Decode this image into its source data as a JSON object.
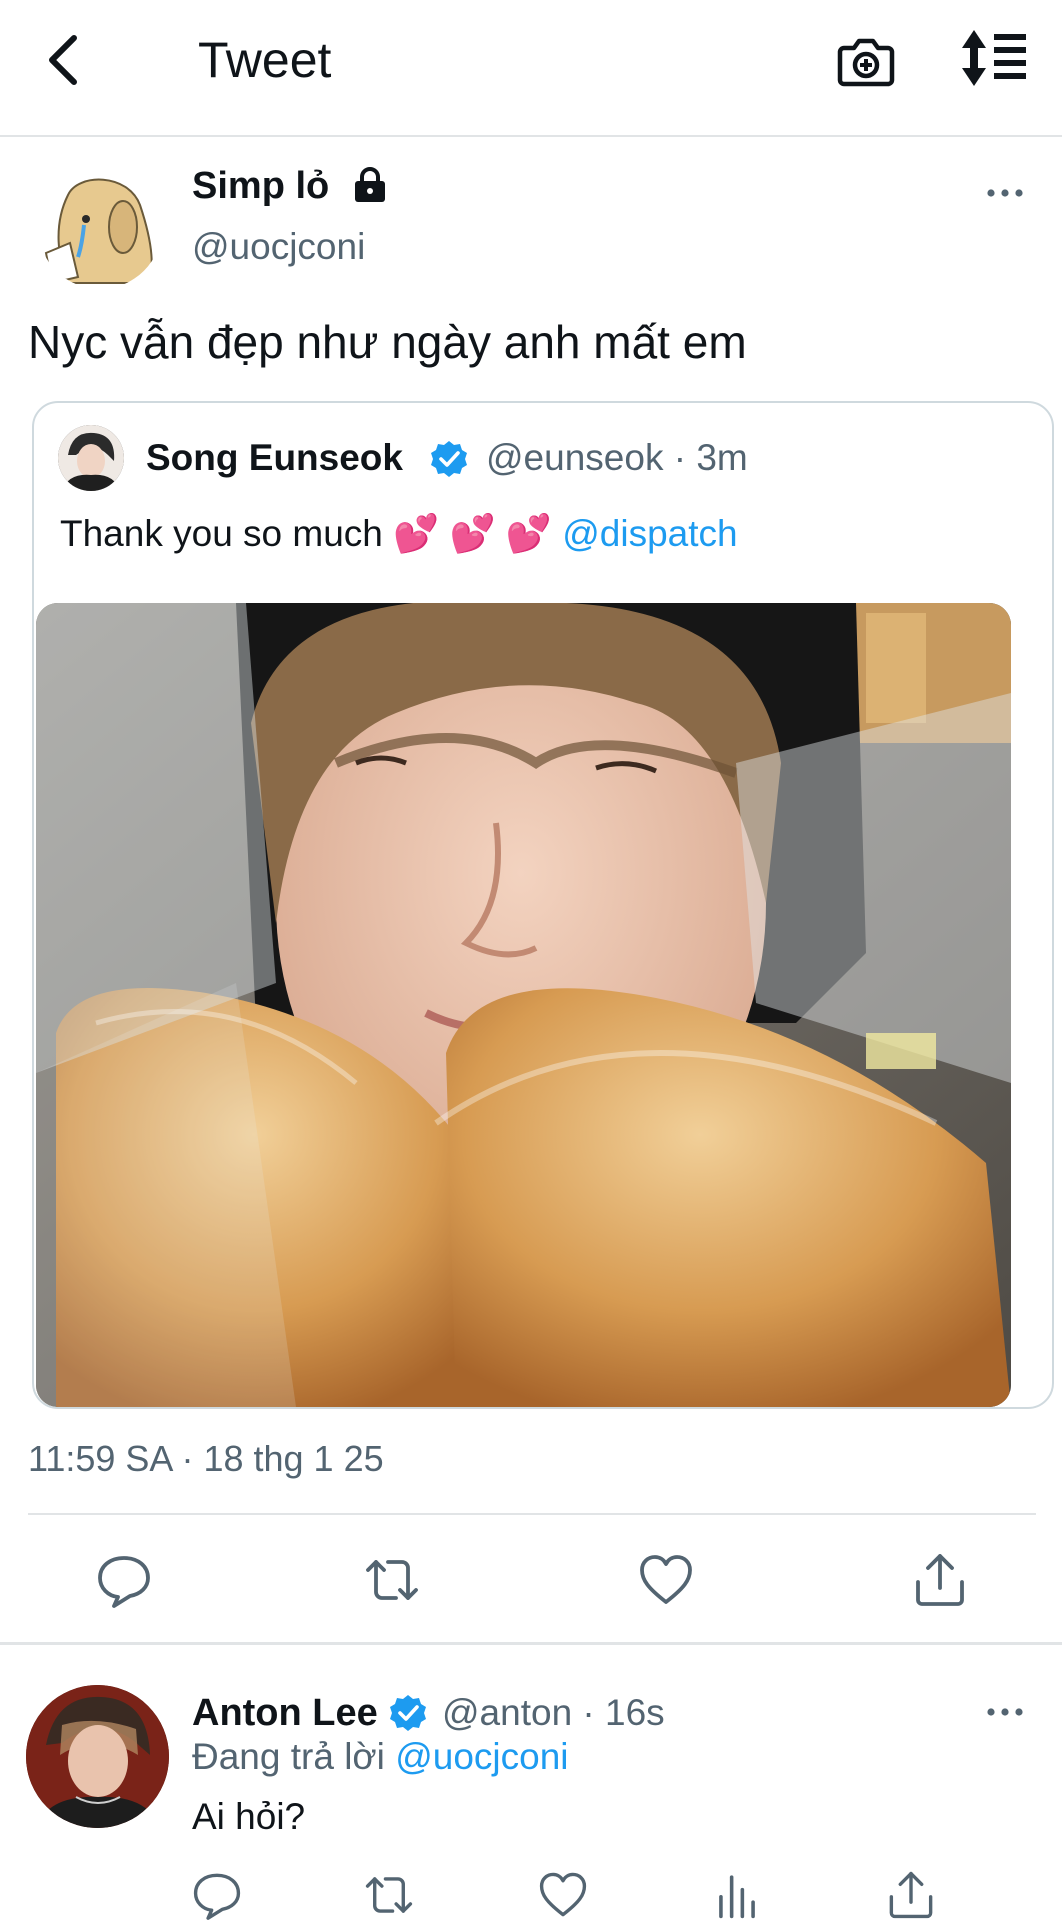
{
  "header": {
    "title": "Tweet",
    "back_icon": "chevron-left-icon",
    "camera_icon": "camera-add-icon",
    "sort_icon": "sort-list-icon"
  },
  "tweet": {
    "author_name": "Simp lỏ",
    "author_handle": "@uocjconi",
    "text": "Nyc vẫn đẹp như ngày anh mất em",
    "timestamp": "11:59 SA · 18 thg 1 25",
    "quote": {
      "author_name": "Song Eunseok",
      "author_handle": "@eunseok · 3m",
      "text": "Thank you so much 💕 💕 💕 ",
      "mention": "@dispatch"
    },
    "actions": [
      "reply-icon",
      "retweet-icon",
      "like-icon",
      "share-icon"
    ]
  },
  "reply": {
    "author_name": "Anton Lee",
    "author_handle": "@anton · 16s",
    "replying_prefix": "Đang trả lời ",
    "replying_to": "@uocjconi",
    "text": "Ai hỏi?",
    "actions": [
      "reply-icon",
      "retweet-icon",
      "like-icon",
      "analytics-icon",
      "share-icon"
    ]
  },
  "colors": {
    "accent": "#1d9bf0",
    "secondary_text": "#536471",
    "divider": "#e1e4e6"
  }
}
